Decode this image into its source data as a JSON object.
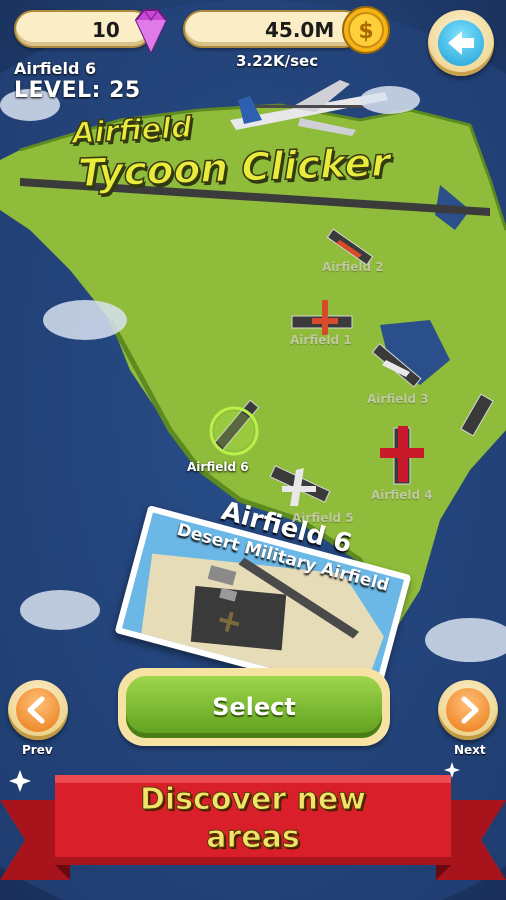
{
  "hud": {
    "gems": "10",
    "gem_icon": "gem-icon",
    "coins": "45.0M",
    "coin_icon": "coin-icon",
    "rate": "3.22K/sec",
    "back_icon": "back-arrow-icon"
  },
  "player": {
    "current_field": "Airfield 6",
    "level": "LEVEL: 25"
  },
  "logo": {
    "line1": "Airfield",
    "line2": "Tycoon Clicker"
  },
  "map": {
    "airfields": [
      {
        "label": "Airfield 2",
        "active": false
      },
      {
        "label": "Airfield 1",
        "active": false
      },
      {
        "label": "Airfield 3",
        "active": false
      },
      {
        "label": "Airfield 6",
        "active": true
      },
      {
        "label": "Airfield 4",
        "active": false
      },
      {
        "label": "Airfield 5",
        "active": false
      }
    ]
  },
  "selection": {
    "title": "Airfield 6",
    "subtitle": "Desert Military Airfield",
    "select_label": "Select",
    "prev_label": "Prev",
    "next_label": "Next"
  },
  "banner": {
    "line1": "Discover new",
    "line2": "areas"
  },
  "colors": {
    "ocean": "#1e3868",
    "land": "#8fbc3a",
    "button_green": "#7cbf2e",
    "banner_red": "#d81f2a",
    "accent_orange": "#ea7a14"
  }
}
